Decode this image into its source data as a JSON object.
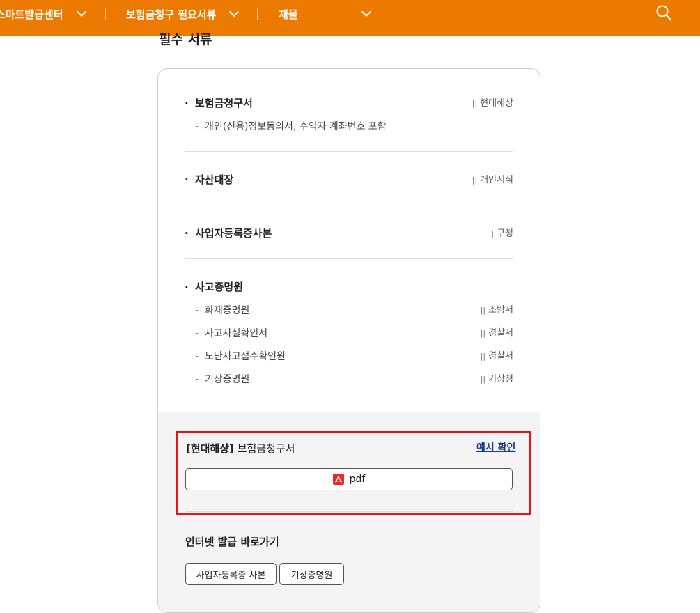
{
  "nav": {
    "items": [
      {
        "label": "스마트발급센터"
      },
      {
        "label": "보험금청구 필요서류"
      },
      {
        "label": "재물"
      }
    ]
  },
  "page": {
    "section_title": "필수 서류"
  },
  "documents": [
    {
      "title": "보험금청구서",
      "issuer": "현대해상",
      "sub": "개인(신용)정보동의서, 수익자 계좌번호 포함"
    },
    {
      "title": "자산대장",
      "issuer": "개인서식"
    },
    {
      "title": "사업자등록증사본",
      "issuer": "구청"
    },
    {
      "title": "사고증명원",
      "items": [
        {
          "label": "화재증명원",
          "issuer": "소방서"
        },
        {
          "label": "사고사실확인서",
          "issuer": "경찰서"
        },
        {
          "label": "도난사고접수확인원",
          "issuer": "경찰서"
        },
        {
          "label": "기상증명원",
          "issuer": "기상청"
        }
      ]
    }
  ],
  "form_download": {
    "company": "[현대해상]",
    "title": "보험금청구서",
    "example_link": "예시 확인",
    "pdf_label": "pdf"
  },
  "quick_links": {
    "title": "인터넷 발급 바로가기",
    "buttons": [
      {
        "label": "사업자등록증 사본"
      },
      {
        "label": "기상증명원"
      }
    ]
  },
  "colors": {
    "brand_orange": "#ed7a00",
    "highlight_red": "#e4161d",
    "link_blue": "#1a3a8a"
  }
}
